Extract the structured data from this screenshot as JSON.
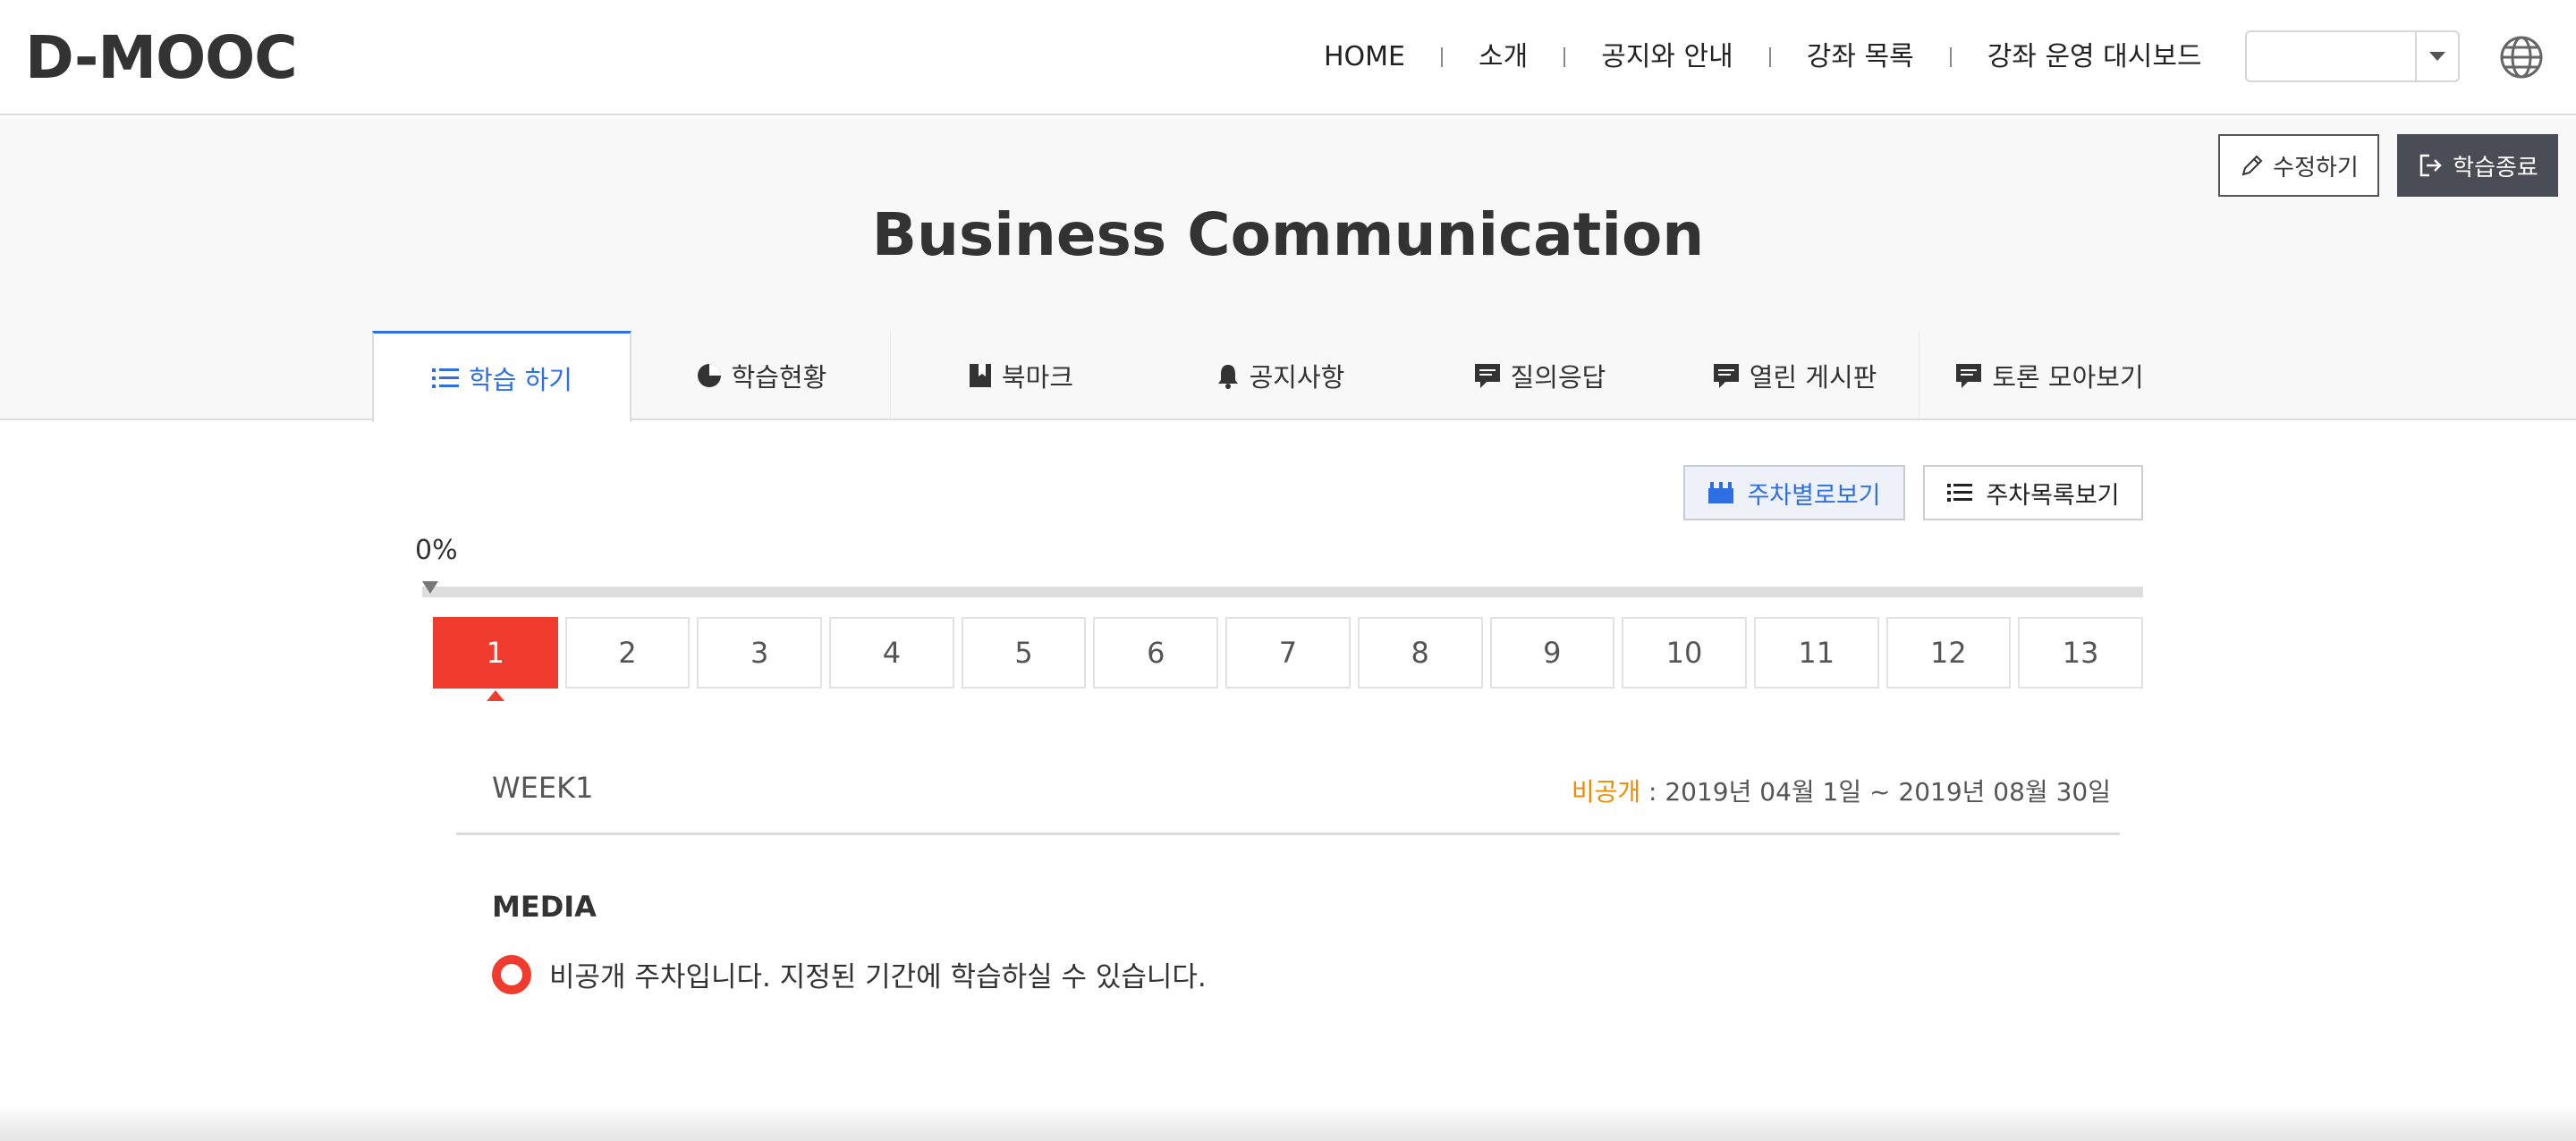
{
  "header": {
    "logo": "D-MOOC",
    "nav": [
      "HOME",
      "소개",
      "공지와 안내",
      "강좌 목록",
      "강좌 운영 대시보드"
    ],
    "language_select_value": ""
  },
  "course": {
    "title": "Business Communication",
    "edit_label": "수정하기",
    "exit_label": "학습종료"
  },
  "tabs": [
    {
      "label": "학습 하기",
      "icon": "list-icon",
      "active": true
    },
    {
      "label": "학습현황",
      "icon": "pie-chart-icon",
      "active": false
    },
    {
      "label": "북마크",
      "icon": "bookmark-icon",
      "active": false
    },
    {
      "label": "공지사항",
      "icon": "bell-icon",
      "active": false
    },
    {
      "label": "질의응답",
      "icon": "chat-icon",
      "active": false
    },
    {
      "label": "열린 게시판",
      "icon": "chat-icon",
      "active": false
    },
    {
      "label": "토론 모아보기",
      "icon": "chat-icon",
      "active": false
    }
  ],
  "view": {
    "by_week_label": "주차별로보기",
    "list_label": "주차목록보기"
  },
  "progress": {
    "percent_label": "0%",
    "value": 0
  },
  "weeks": [
    "1",
    "2",
    "3",
    "4",
    "5",
    "6",
    "7",
    "8",
    "9",
    "10",
    "11",
    "12",
    "13"
  ],
  "selected_week": {
    "label": "WEEK1",
    "status": "비공개",
    "period": " : 2019년 04월 1일 ~ 2019년 08월 30일",
    "section": "MEDIA",
    "notice": "비공개 주차입니다. 지정된 기간에 학습하실 수 있습니다."
  },
  "colors": {
    "accent_blue": "#2f6fe4",
    "active_red": "#f03c2f",
    "status_orange": "#f08a00",
    "dark_button": "#4a4d55"
  }
}
